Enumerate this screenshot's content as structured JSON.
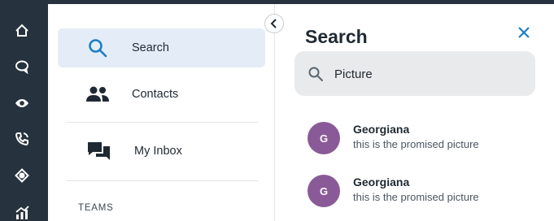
{
  "rail": {
    "icons": [
      "home-icon",
      "chat-icon",
      "eye-icon",
      "phone-icon",
      "target-icon",
      "analytics-icon"
    ]
  },
  "nav": {
    "items": [
      {
        "label": "Search",
        "icon": "search-icon",
        "active": true
      },
      {
        "label": "Contacts",
        "icon": "contacts-icon",
        "active": false
      },
      {
        "label": "My Inbox",
        "icon": "inbox-icon",
        "active": false
      }
    ],
    "section_label": "TEAMS"
  },
  "search_pane": {
    "title": "Search",
    "query": "Picture",
    "results": [
      {
        "initial": "G",
        "name": "Georgiana",
        "snippet": "this is the promised picture"
      },
      {
        "initial": "G",
        "name": "Georgiana",
        "snippet": "this is the promised picture"
      }
    ]
  },
  "colors": {
    "rail_bg": "#26323d",
    "active_nav_bg": "#e4edf7",
    "accent_blue": "#1b7fc4",
    "avatar_purple": "#8a5a98",
    "search_box_bg": "#e9eaeb"
  }
}
